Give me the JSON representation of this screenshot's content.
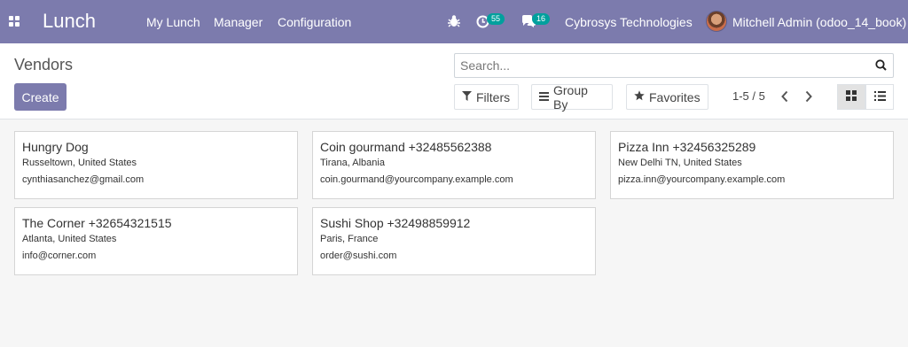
{
  "navbar": {
    "brand": "Lunch",
    "menu": [
      "My Lunch",
      "Manager",
      "Configuration"
    ],
    "activity_count": "55",
    "messages_count": "16",
    "company": "Cybrosys Technologies",
    "user": "Mitchell Admin (odoo_14_book)",
    "color": "#7c7bad"
  },
  "control": {
    "breadcrumb": "Vendors",
    "create_label": "Create",
    "search_placeholder": "Search...",
    "filters_label": "Filters",
    "groupby_label": "Group By",
    "favorites_label": "Favorites",
    "pager": "1-5 / 5"
  },
  "vendors": [
    {
      "name": "Hungry Dog",
      "location": "Russeltown, United States",
      "email": "cynthiasanchez@gmail.com"
    },
    {
      "name": "Coin gourmand +32485562388",
      "location": "Tirana, Albania",
      "email": "coin.gourmand@yourcompany.example.com"
    },
    {
      "name": "Pizza Inn +32456325289",
      "location": "New Delhi TN, United States",
      "email": "pizza.inn@yourcompany.example.com"
    },
    {
      "name": "The Corner +32654321515",
      "location": "Atlanta, United States",
      "email": "info@corner.com"
    },
    {
      "name": "Sushi Shop +32498859912",
      "location": "Paris, France",
      "email": "order@sushi.com"
    }
  ]
}
